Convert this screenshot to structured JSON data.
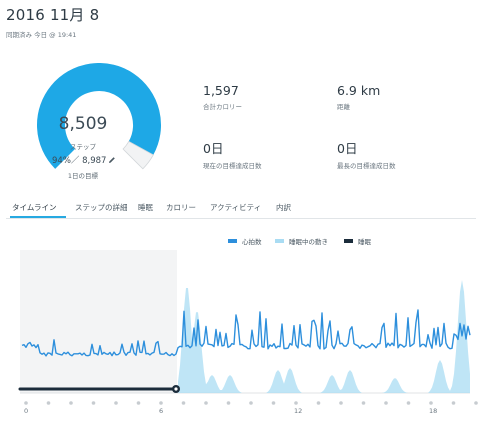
{
  "header": {
    "date_title": "2016 11月 8",
    "sync_status": "同期済み 今日 @ 19:41"
  },
  "steps": {
    "value": "8,509",
    "unit_label": "ステップ",
    "goal_text": "94%／ 8,987",
    "goal_label": "1日の目標",
    "progress_fraction": 0.94,
    "edit_icon": "pencil-icon",
    "accent_color": "#1ea8e6",
    "remaining_color": "#f2f3f4"
  },
  "stats": {
    "calories_value": "1,597",
    "calories_label": "合計カロリー",
    "distance_value": "6.9 km",
    "distance_label": "距離",
    "current_streak_value": "0日",
    "current_streak_label": "現在の目標達成日数",
    "longest_streak_value": "0日",
    "longest_streak_label": "最長の目標達成日数"
  },
  "tabs": [
    {
      "label": "タイムライン",
      "active": true
    },
    {
      "label": "ステップの詳細",
      "active": false
    },
    {
      "label": "睡眠",
      "active": false
    },
    {
      "label": "カロリー",
      "active": false
    },
    {
      "label": "アクティビティ",
      "active": false
    },
    {
      "label": "内訳",
      "active": false
    }
  ],
  "legend": {
    "heart_rate": "心拍数",
    "sleep_movement": "睡眠中の動き",
    "sleep": "睡眠"
  },
  "colors": {
    "heart_rate": "#2d8fdc",
    "sleep_movement": "#a9dcf3",
    "sleep": "#1b2c3b",
    "shaded_region": "#f3f4f5"
  },
  "timeline": {
    "hour_labels": [
      "0",
      "6",
      "12",
      "18"
    ]
  }
}
